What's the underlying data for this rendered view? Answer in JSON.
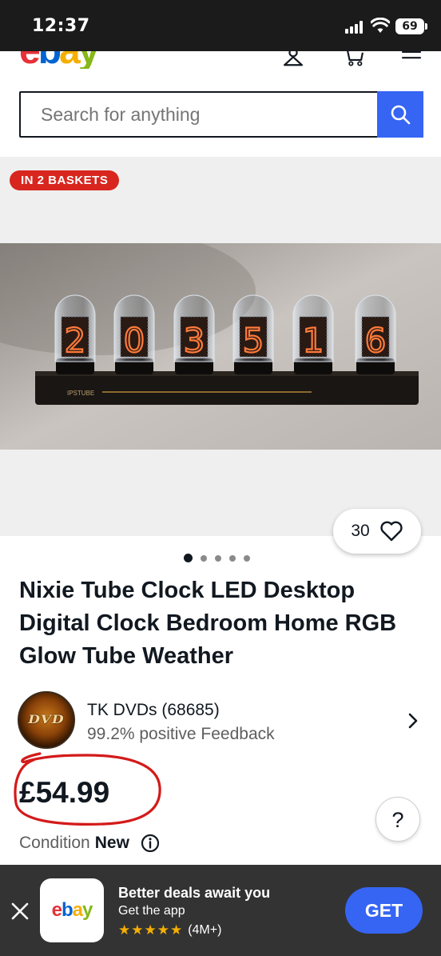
{
  "status_bar": {
    "time": "12:37",
    "battery": "69"
  },
  "header": {
    "logo": {
      "e": "e",
      "b": "b",
      "a": "a",
      "y": "y"
    },
    "search": {
      "placeholder": "Search for anything"
    }
  },
  "gallery": {
    "badge": "IN 2 BASKETS",
    "clock_digits": [
      "2",
      "0",
      "3",
      "5",
      "1",
      "6"
    ],
    "brand_mark": "IPSTUBE",
    "watch_count": "30",
    "image_count": 5,
    "active_image": 1
  },
  "listing": {
    "title": "Nixie Tube Clock LED Desktop Digital Clock Bedroom Home RGB Glow Tube Weather",
    "seller": {
      "avatar_text": "DVD",
      "name": "TK DVDs (68685)",
      "feedback": "99.2% positive Feedback"
    },
    "price": "£54.99",
    "condition_label": "Condition",
    "condition_value": "New",
    "help": "?"
  },
  "app_banner": {
    "app_logo": {
      "e": "e",
      "b": "b",
      "a": "a",
      "y": "y"
    },
    "title": "Better deals await you",
    "subtitle": "Get the app",
    "stars": "★★★★★",
    "rating_count": "(4M+)",
    "get_label": "GET"
  },
  "colors": {
    "accent_blue": "#3665f3",
    "badge_red": "#d8261f",
    "logo_red": "#e53238",
    "logo_blue": "#0064d2",
    "logo_yellow": "#f5af02",
    "logo_green": "#86b817",
    "price_annotation": "#d41a1a"
  }
}
